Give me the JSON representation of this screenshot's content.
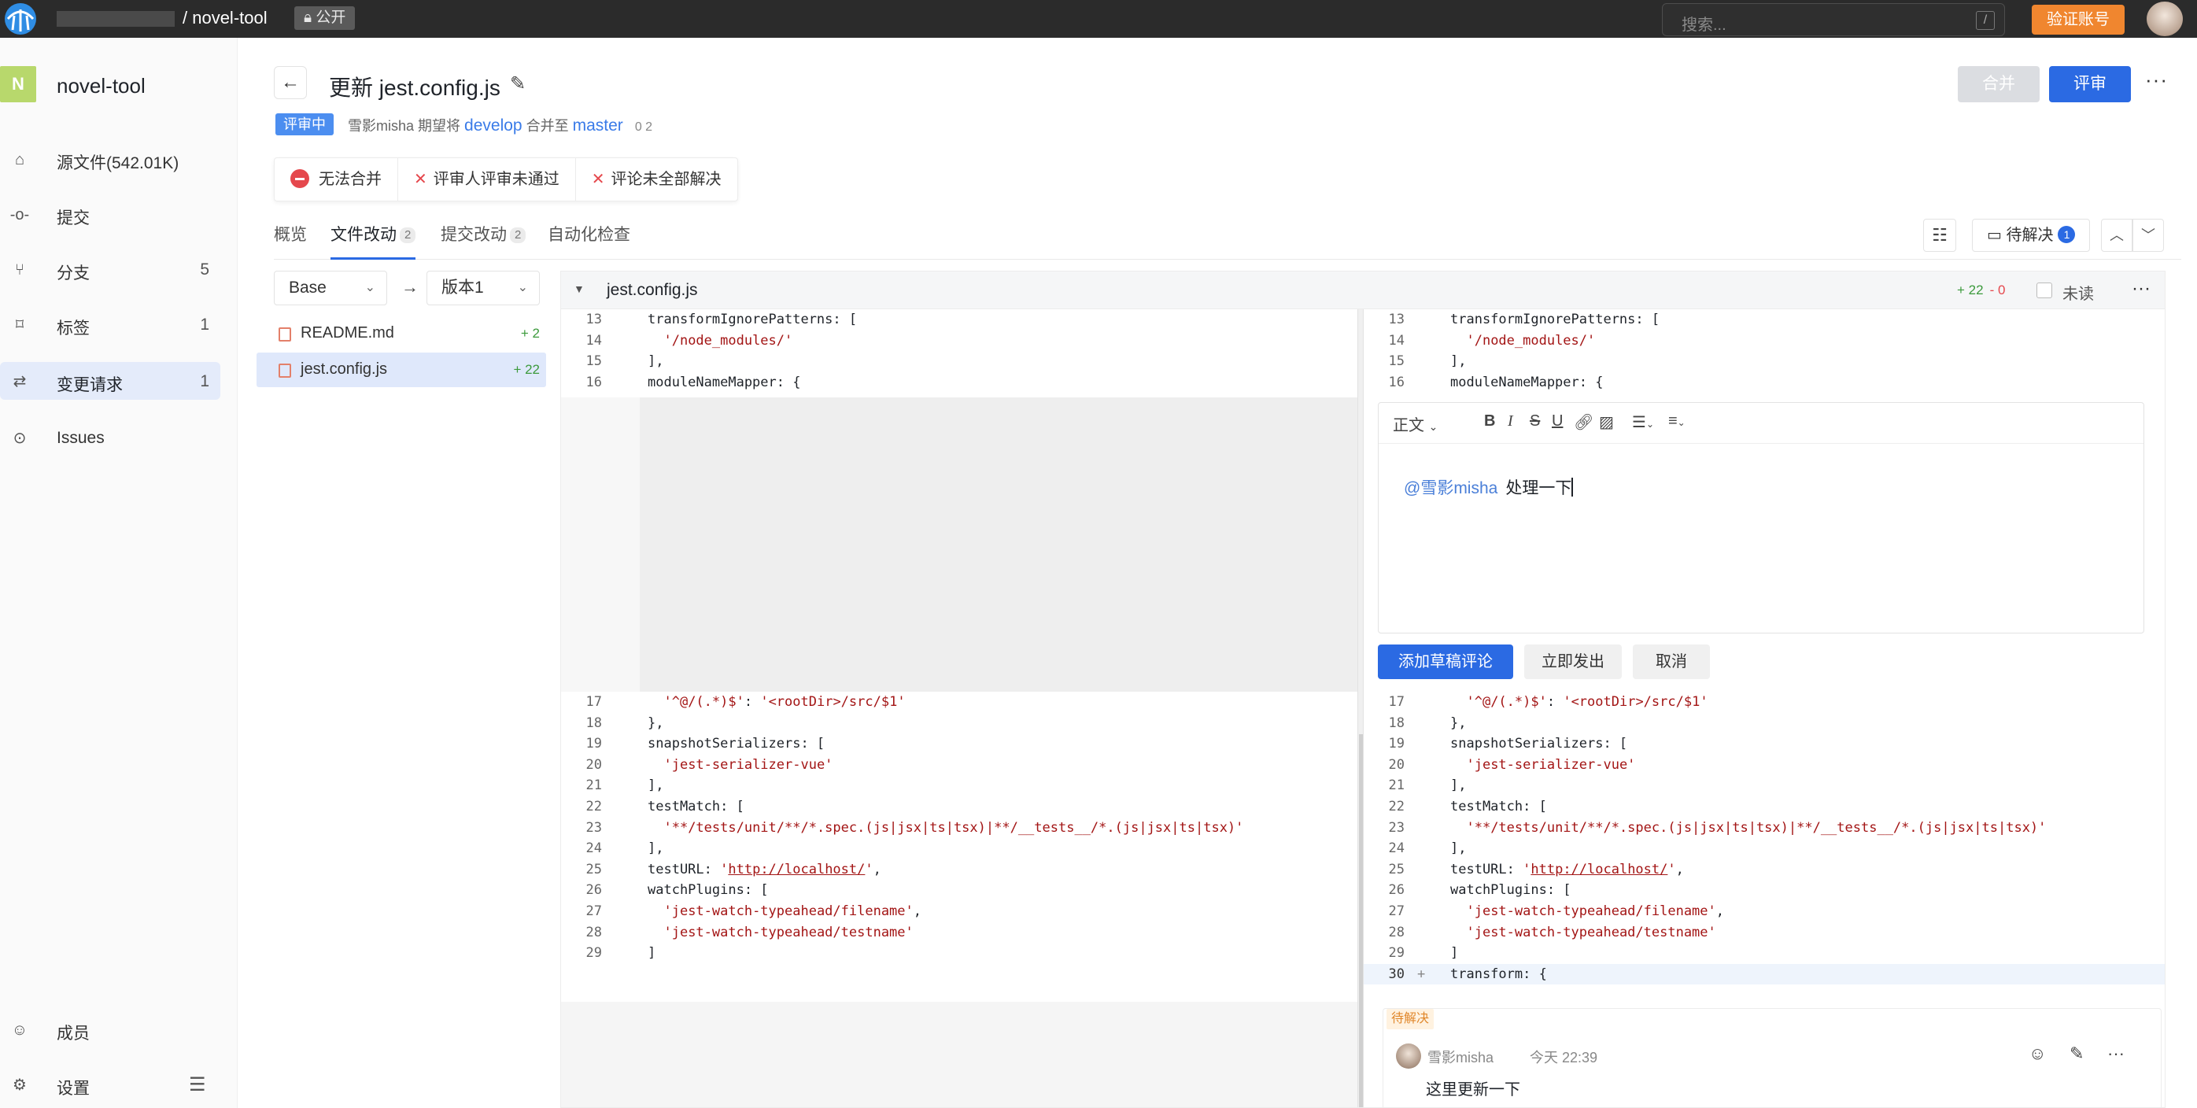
{
  "topbar": {
    "path": "/ novel-tool",
    "visibility": "公开",
    "search_placeholder": "搜索...",
    "search_shortcut": "/",
    "verify_label": "验证账号"
  },
  "sidebar": {
    "project_initial": "N",
    "project_name": "novel-tool",
    "items": [
      {
        "label": "源文件(542.01K)",
        "count": "",
        "icon": "home-icon"
      },
      {
        "label": "提交",
        "count": "",
        "icon": "commit-icon"
      },
      {
        "label": "分支",
        "count": "5",
        "icon": "branch-icon"
      },
      {
        "label": "标签",
        "count": "1",
        "icon": "tag-icon"
      },
      {
        "label": "变更请求",
        "count": "1",
        "icon": "merge-request-icon"
      },
      {
        "label": "Issues",
        "count": "",
        "icon": "issues-icon"
      }
    ],
    "bottom": [
      {
        "label": "成员",
        "icon": "user-icon"
      },
      {
        "label": "设置",
        "icon": "settings-icon"
      }
    ]
  },
  "header": {
    "title": "更新 jest.config.js",
    "status": "评审中",
    "meta_prefix": "雪影misha 期望将",
    "source_branch": "develop",
    "meta_mid": "合并至",
    "target_branch": "master",
    "counts": "0 2",
    "merge_label": "合并",
    "review_label": "评审"
  },
  "checks": [
    "无法合并",
    "评审人评审未通过",
    "评论未全部解决"
  ],
  "tabs": [
    {
      "label": "概览",
      "count": ""
    },
    {
      "label": "文件改动",
      "count": "2"
    },
    {
      "label": "提交改动",
      "count": "2"
    },
    {
      "label": "自动化检查",
      "count": ""
    }
  ],
  "pending": {
    "label": "待解决",
    "count": "1"
  },
  "compare": {
    "base": "Base",
    "target": "版本1"
  },
  "files": [
    {
      "name": "README.md",
      "additions": "+ 2"
    },
    {
      "name": "jest.config.js",
      "additions": "+ 22"
    }
  ],
  "diff": {
    "file": "jest.config.js",
    "additions": "+ 22",
    "deletions": "- 0",
    "unread_label": "未读",
    "top_lines": [
      {
        "no": "13",
        "text": "transformIgnorePatterns: ["
      },
      {
        "no": "14",
        "text": "  '/node_modules/'"
      },
      {
        "no": "15",
        "text": "],"
      },
      {
        "no": "16",
        "text": "moduleNameMapper: {"
      }
    ],
    "bottom_lines": [
      {
        "no": "17",
        "text": "  '^@/(.*)$': '<rootDir>/src/$1'"
      },
      {
        "no": "18",
        "text": "},"
      },
      {
        "no": "19",
        "text": "snapshotSerializers: ["
      },
      {
        "no": "20",
        "text": "  'jest-serializer-vue'"
      },
      {
        "no": "21",
        "text": "],"
      },
      {
        "no": "22",
        "text": "testMatch: ["
      },
      {
        "no": "23",
        "text": "  '**/tests/unit/**/*.spec.(js|jsx|ts|tsx)|**/__tests__/*.(js|jsx|ts|tsx)'"
      },
      {
        "no": "24",
        "text": "],"
      },
      {
        "no": "25",
        "text": "testURL: 'http://localhost/',"
      },
      {
        "no": "26",
        "text": "watchPlugins: ["
      },
      {
        "no": "27",
        "text": "  'jest-watch-typeahead/filename',"
      },
      {
        "no": "28",
        "text": "  'jest-watch-typeahead/testname'"
      },
      {
        "no": "29",
        "text": "]"
      }
    ],
    "added_line": {
      "no": "30",
      "text": "transform: {"
    }
  },
  "editor": {
    "format": "正文",
    "mention": "@雪影misha",
    "text": "处理一下",
    "add_draft": "添加草稿评论",
    "send_now": "立即发出",
    "cancel": "取消"
  },
  "comment": {
    "tag": "待解决",
    "user": "雪影misha",
    "time": "今天 22:39",
    "text": "这里更新一下"
  }
}
